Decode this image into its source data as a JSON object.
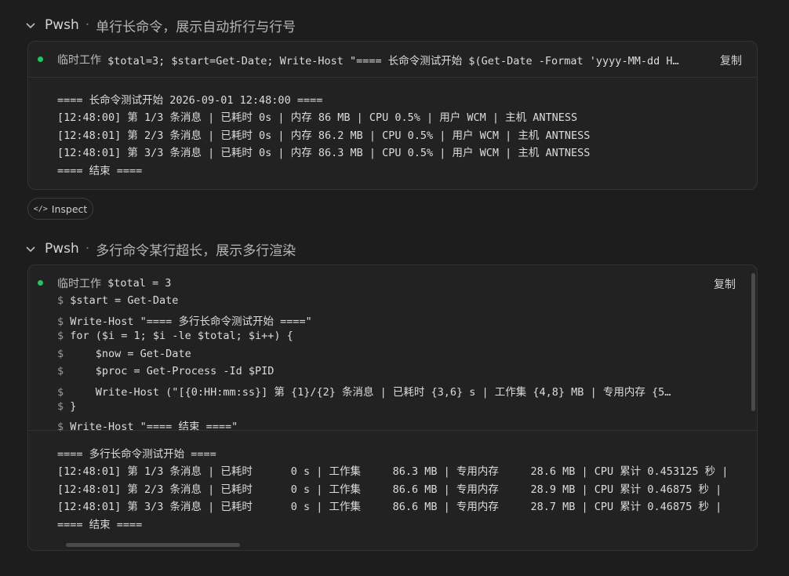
{
  "section1": {
    "title": "Pwsh",
    "separator": "·",
    "description": "单行长命令，展示自动折行与行号",
    "card": {
      "command_label": "临时工作",
      "command": " $total=3; $start=Get-Date; Write-Host \"==== 长命令测试开始 $(Get-Date -Format 'yyyy-MM-dd H…",
      "copy_label": "复制",
      "output": [
        "==== 长命令测试开始 2026-09-01 12:48:00 ====",
        "[12:48:00] 第 1/3 条消息 | 已耗时 0s | 内存 86 MB | CPU 0.5% | 用户 WCM | 主机 ANTNESS",
        "[12:48:01] 第 2/3 条消息 | 已耗时 0s | 内存 86.2 MB | CPU 0.5% | 用户 WCM | 主机 ANTNESS",
        "[12:48:01] 第 3/3 条消息 | 已耗时 0s | 内存 86.3 MB | CPU 0.5% | 用户 WCM | 主机 ANTNESS",
        "==== 结束 ===="
      ]
    }
  },
  "inspect": {
    "icon": "</>",
    "label": "Inspect"
  },
  "section2": {
    "title": "Pwsh",
    "separator": "·",
    "description": "多行命令某行超长，展示多行渲染",
    "card": {
      "command_label": "临时工作",
      "first_line": " $total = 3",
      "copy_label": "复制",
      "prompt": "$",
      "command_lines": [
        " $start = Get-Date",
        " Write-Host \"==== 多行长命令测试开始 ====\"",
        " for ($i = 1; $i -le $total; $i++) {",
        "     $now = Get-Date",
        "     $proc = Get-Process -Id $PID",
        "     Write-Host (\"[{0:HH:mm:ss}] 第 {1}/{2} 条消息 | 已耗时 {3,6} s | 工作集 {4,8} MB | 专用内存 {5…",
        " }",
        " Write-Host \"==== 结束 ====\""
      ],
      "output": [
        "==== 多行长命令测试开始 ====",
        "[12:48:01] 第 1/3 条消息 | 已耗时      0 s | 工作集     86.3 MB | 专用内存     28.6 MB | CPU 累计 0.453125 秒 |",
        "[12:48:01] 第 2/3 条消息 | 已耗时      0 s | 工作集     86.6 MB | 专用内存     28.9 MB | CPU 累计 0.46875 秒 | ",
        "[12:48:01] 第 3/3 条消息 | 已耗时      0 s | 工作集     86.6 MB | 专用内存     28.7 MB | CPU 累计 0.46875 秒 | ",
        "==== 结束 ===="
      ]
    }
  }
}
